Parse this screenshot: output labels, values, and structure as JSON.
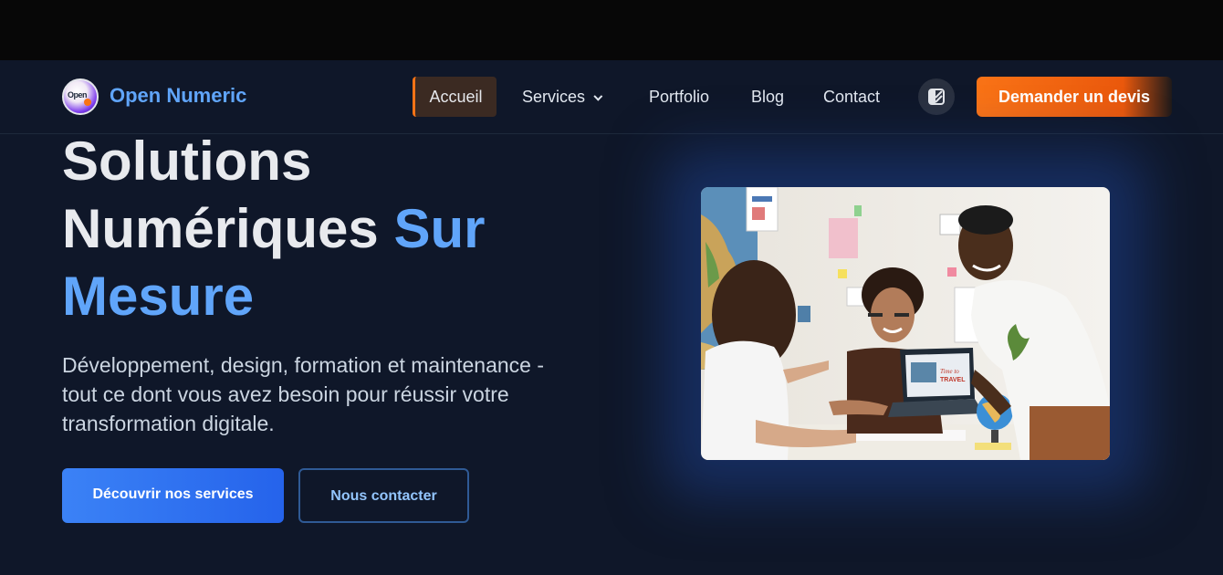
{
  "brand": {
    "name": "Open Numeric",
    "logo_text": "Open"
  },
  "nav": {
    "items": [
      {
        "label": "Accueil",
        "active": true
      },
      {
        "label": "Services",
        "has_dropdown": true
      },
      {
        "label": "Portfolio"
      },
      {
        "label": "Blog"
      },
      {
        "label": "Contact"
      }
    ],
    "theme_icon": "theme-toggle-icon",
    "cta_label": "Demander un devis"
  },
  "hero": {
    "title_line1": "Solutions",
    "title_line2": "Numériques",
    "title_accent_1": "Sur",
    "title_accent_2": "Mesure",
    "subtitle": "Développement, design, formation et maintenance - tout ce dont vous avez besoin pour réussir votre transformation digitale.",
    "primary_button": "Découvrir nos services",
    "secondary_button": "Nous contacter",
    "image_laptop_text_1": "Time to",
    "image_laptop_text_2": "TRAVEL"
  },
  "colors": {
    "background": "#0f1729",
    "accent_blue": "#60a5fa",
    "accent_orange": "#f97316",
    "primary_button": "#2563eb"
  }
}
